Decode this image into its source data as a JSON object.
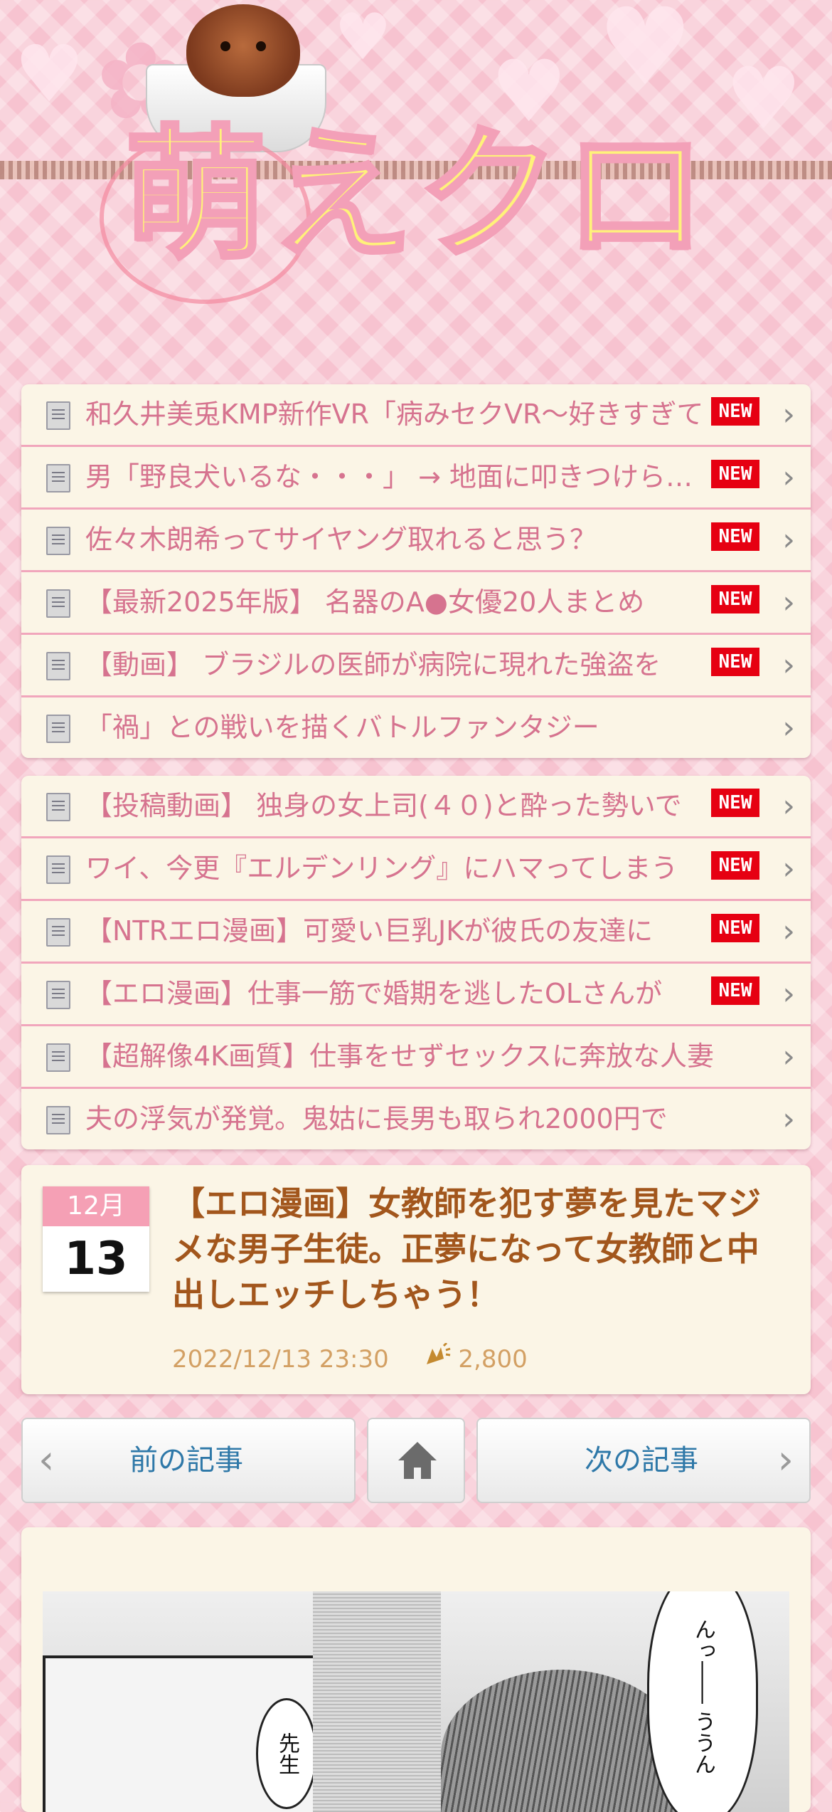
{
  "site": {
    "logo_text": "萌えクロ"
  },
  "list_primary": [
    {
      "text": "和久井美兎KMP新作VR「病みセクVR～好きすぎて",
      "new": true
    },
    {
      "text": "男「野良犬いるな・・・」 → 地面に叩きつけられる",
      "new": true
    },
    {
      "text": "佐々木朗希ってサイヤング取れると思う？",
      "new": true
    },
    {
      "text": "【最新2025年版】 名器のA●女優20人まとめ",
      "new": true
    },
    {
      "text": "【動画】 ブラジルの医師が病院に現れた強盗を",
      "new": true
    },
    {
      "text": "「禍」との戦いを描くバトルファンタジー",
      "new": false
    }
  ],
  "list_secondary": [
    {
      "text": "【投稿動画】 独身の女上司(４０)と酔った勢いで",
      "new": true
    },
    {
      "text": "ワイ、今更『エルデンリング』にハマってしまう",
      "new": true
    },
    {
      "text": "【NTRエロ漫画】可愛い巨乳JKが彼氏の友達に",
      "new": true
    },
    {
      "text": "【エロ漫画】仕事一筋で婚期を逃したOLさんが",
      "new": true
    },
    {
      "text": "【超解像4K画質】仕事をせずセックスに奔放な人妻",
      "new": false
    },
    {
      "text": "夫の浮気が発覚。鬼姑に長男も取られ2000円で",
      "new": false
    }
  ],
  "badge_label": "NEW",
  "article": {
    "month": "12月",
    "day": "13",
    "title": "【エロ漫画】女教師を犯す夢を見たマジメな男子生徒。正夢になって女教師と中出しエッチしちゃう！",
    "datetime": "2022/12/13 23:30",
    "claps": "2,800",
    "clap_icon": "clap-icon"
  },
  "nav": {
    "prev_label": "前の記事",
    "next_label": "次の記事",
    "home_icon": "home-icon"
  },
  "manga": {
    "bubble_right": "んっ―― ううん",
    "bubble_left": "先生"
  },
  "colors": {
    "background": "#f7c3d0",
    "item_text": "#d6738f",
    "title": "#a2561c",
    "badge": "#e60012",
    "nav_text": "#2e78a8"
  }
}
